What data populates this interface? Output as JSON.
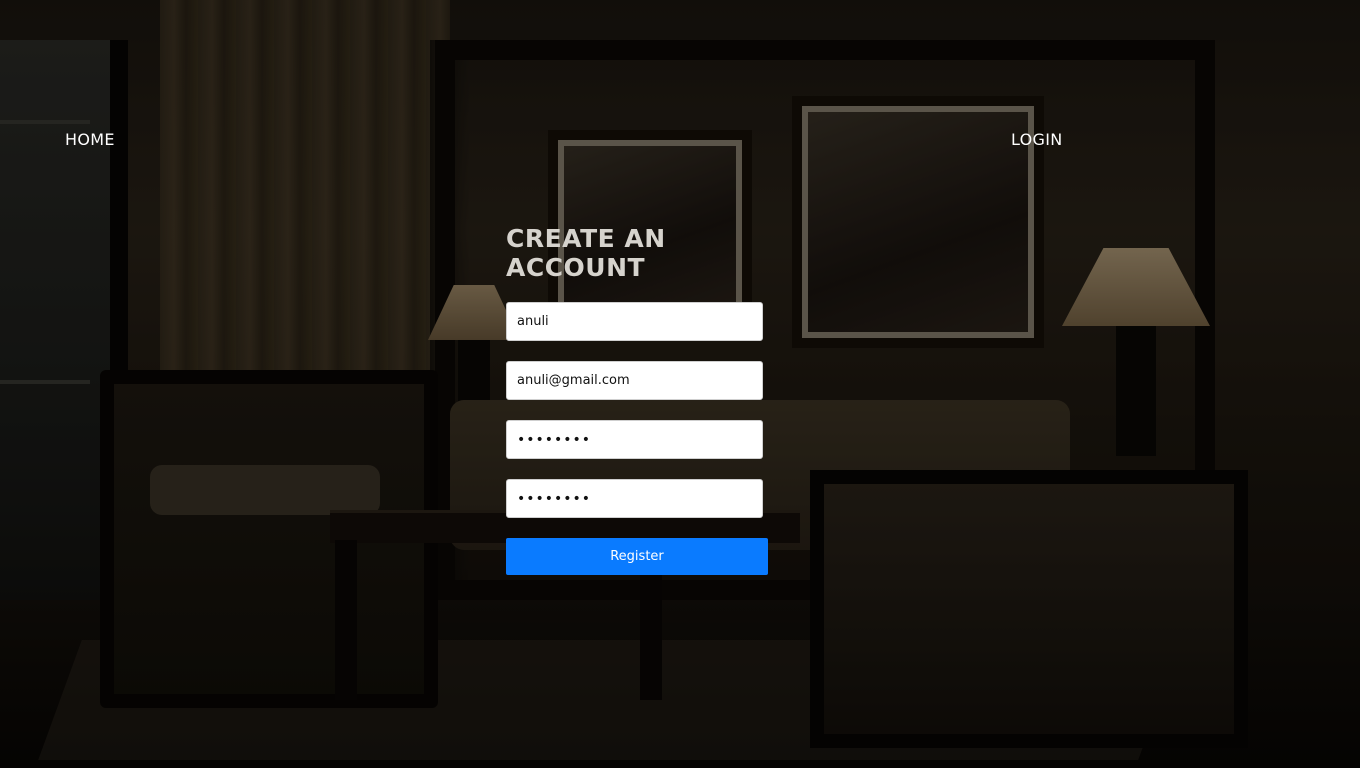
{
  "nav": {
    "home_label": "HOME",
    "login_label": "LOGIN"
  },
  "form": {
    "title": "CREATE AN ACCOUNT",
    "username_value": "anuli",
    "email_value": "anuli@gmail.com",
    "password_value": "••••••••",
    "confirm_password_value": "••••••••",
    "register_label": "Register"
  },
  "colors": {
    "accent": "#0a7bff",
    "title_text": "#d6d3cd",
    "nav_text": "#ffffff"
  },
  "background": {
    "scene": "dimly-lit living room with chairs, sofa, lamps and framed pictures"
  }
}
